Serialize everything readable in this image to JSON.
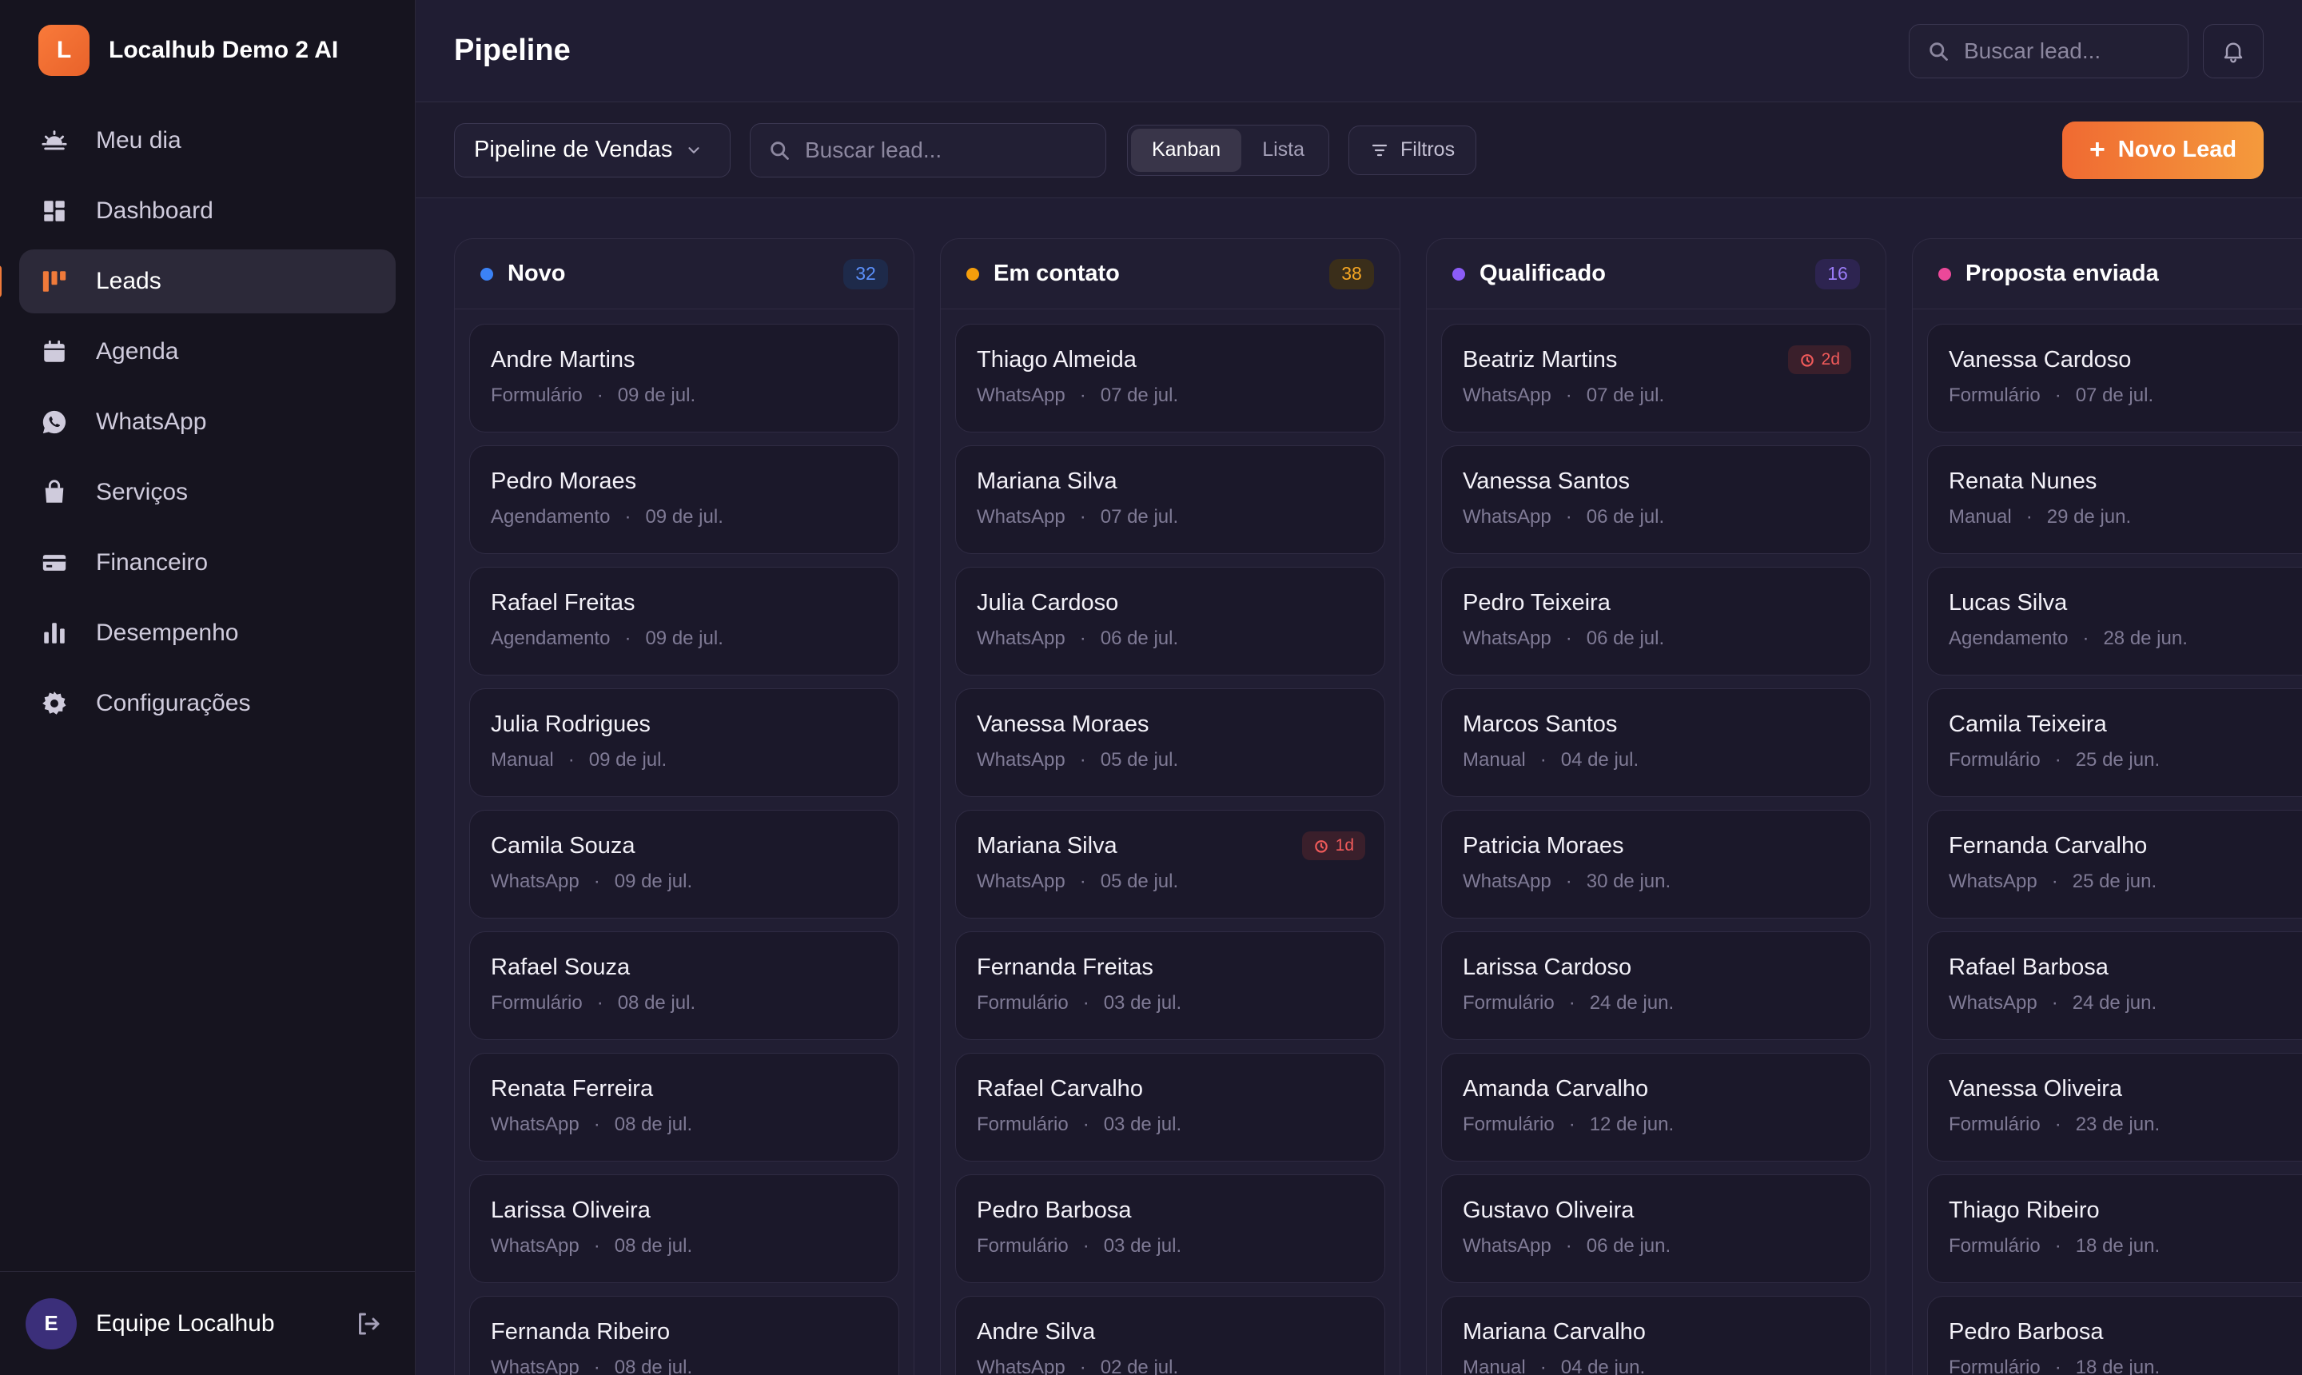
{
  "brand": {
    "initial": "L",
    "name": "Localhub Demo 2 AI"
  },
  "nav": [
    {
      "label": "Meu dia",
      "icon": "sun-icon",
      "active": false
    },
    {
      "label": "Dashboard",
      "icon": "dashboard-icon",
      "active": false
    },
    {
      "label": "Leads",
      "icon": "kanban-icon",
      "active": true
    },
    {
      "label": "Agenda",
      "icon": "calendar-icon",
      "active": false
    },
    {
      "label": "WhatsApp",
      "icon": "whatsapp-icon",
      "active": false
    },
    {
      "label": "Serviços",
      "icon": "bag-icon",
      "active": false
    },
    {
      "label": "Financeiro",
      "icon": "credit-card-icon",
      "active": false
    },
    {
      "label": "Desempenho",
      "icon": "bar-chart-icon",
      "active": false
    },
    {
      "label": "Configurações",
      "icon": "gear-icon",
      "active": false
    }
  ],
  "footer": {
    "avatar_initial": "E",
    "team_name": "Equipe Localhub"
  },
  "header": {
    "title": "Pipeline",
    "search_placeholder": "Buscar lead..."
  },
  "toolbar": {
    "pipeline": "Pipeline de Vendas",
    "search_placeholder": "Buscar lead...",
    "view_kanban": "Kanban",
    "view_list": "Lista",
    "filters": "Filtros",
    "new_lead": "Novo Lead"
  },
  "colors": {
    "accent": "#f07a3a",
    "novo": "#3b82f6",
    "em_contato": "#f59e0b",
    "qualificado": "#8b5cf6",
    "proposta": "#ec4899",
    "alert": "#f05a5a"
  },
  "columns": [
    {
      "title": "Novo",
      "count": "32",
      "color": "#3b82f6",
      "count_bg": "#1e2a4a",
      "count_fg": "#5b8ff9",
      "cards": [
        {
          "name": "Andre Martins",
          "source": "Formulário",
          "date": "09 de jul."
        },
        {
          "name": "Pedro Moraes",
          "source": "Agendamento",
          "date": "09 de jul."
        },
        {
          "name": "Rafael Freitas",
          "source": "Agendamento",
          "date": "09 de jul."
        },
        {
          "name": "Julia Rodrigues",
          "source": "Manual",
          "date": "09 de jul."
        },
        {
          "name": "Camila Souza",
          "source": "WhatsApp",
          "date": "09 de jul."
        },
        {
          "name": "Rafael Souza",
          "source": "Formulário",
          "date": "08 de jul."
        },
        {
          "name": "Renata Ferreira",
          "source": "WhatsApp",
          "date": "08 de jul."
        },
        {
          "name": "Larissa Oliveira",
          "source": "WhatsApp",
          "date": "08 de jul."
        },
        {
          "name": "Fernanda Ribeiro",
          "source": "WhatsApp",
          "date": "08 de jul."
        }
      ]
    },
    {
      "title": "Em contato",
      "count": "38",
      "color": "#f59e0b",
      "count_bg": "#3a2e1a",
      "count_fg": "#f5a623",
      "cards": [
        {
          "name": "Thiago Almeida",
          "source": "WhatsApp",
          "date": "07 de jul."
        },
        {
          "name": "Mariana Silva",
          "source": "WhatsApp",
          "date": "07 de jul."
        },
        {
          "name": "Julia Cardoso",
          "source": "WhatsApp",
          "date": "06 de jul."
        },
        {
          "name": "Vanessa Moraes",
          "source": "WhatsApp",
          "date": "05 de jul."
        },
        {
          "name": "Mariana Silva",
          "source": "WhatsApp",
          "date": "05 de jul.",
          "badge": "1d"
        },
        {
          "name": "Fernanda Freitas",
          "source": "Formulário",
          "date": "03 de jul."
        },
        {
          "name": "Rafael Carvalho",
          "source": "Formulário",
          "date": "03 de jul."
        },
        {
          "name": "Pedro Barbosa",
          "source": "Formulário",
          "date": "03 de jul."
        },
        {
          "name": "Andre Silva",
          "source": "WhatsApp",
          "date": "02 de jul."
        }
      ]
    },
    {
      "title": "Qualificado",
      "count": "16",
      "color": "#8b5cf6",
      "count_bg": "#2d2450",
      "count_fg": "#9b7cf8",
      "cards": [
        {
          "name": "Beatriz Martins",
          "source": "WhatsApp",
          "date": "07 de jul.",
          "badge": "2d"
        },
        {
          "name": "Vanessa Santos",
          "source": "WhatsApp",
          "date": "06 de jul."
        },
        {
          "name": "Pedro Teixeira",
          "source": "WhatsApp",
          "date": "06 de jul."
        },
        {
          "name": "Marcos Santos",
          "source": "Manual",
          "date": "04 de jul."
        },
        {
          "name": "Patricia Moraes",
          "source": "WhatsApp",
          "date": "30 de jun."
        },
        {
          "name": "Larissa Cardoso",
          "source": "Formulário",
          "date": "24 de jun."
        },
        {
          "name": "Amanda Carvalho",
          "source": "Formulário",
          "date": "12 de jun."
        },
        {
          "name": "Gustavo Oliveira",
          "source": "WhatsApp",
          "date": "06 de jun."
        },
        {
          "name": "Mariana Carvalho",
          "source": "Manual",
          "date": "04 de jun."
        }
      ]
    },
    {
      "title": "Proposta enviada",
      "count": "",
      "color": "#ec4899",
      "count_bg": "#3a1f33",
      "count_fg": "#ec4899",
      "cards": [
        {
          "name": "Vanessa Cardoso",
          "source": "Formulário",
          "date": "07 de jul."
        },
        {
          "name": "Renata Nunes",
          "source": "Manual",
          "date": "29 de jun."
        },
        {
          "name": "Lucas Silva",
          "source": "Agendamento",
          "date": "28 de jun."
        },
        {
          "name": "Camila Teixeira",
          "source": "Formulário",
          "date": "25 de jun."
        },
        {
          "name": "Fernanda Carvalho",
          "source": "WhatsApp",
          "date": "25 de jun."
        },
        {
          "name": "Rafael Barbosa",
          "source": "WhatsApp",
          "date": "24 de jun."
        },
        {
          "name": "Vanessa Oliveira",
          "source": "Formulário",
          "date": "23 de jun."
        },
        {
          "name": "Thiago Ribeiro",
          "source": "Formulário",
          "date": "18 de jun."
        },
        {
          "name": "Pedro Barbosa",
          "source": "Formulário",
          "date": "18 de jun."
        }
      ]
    }
  ]
}
